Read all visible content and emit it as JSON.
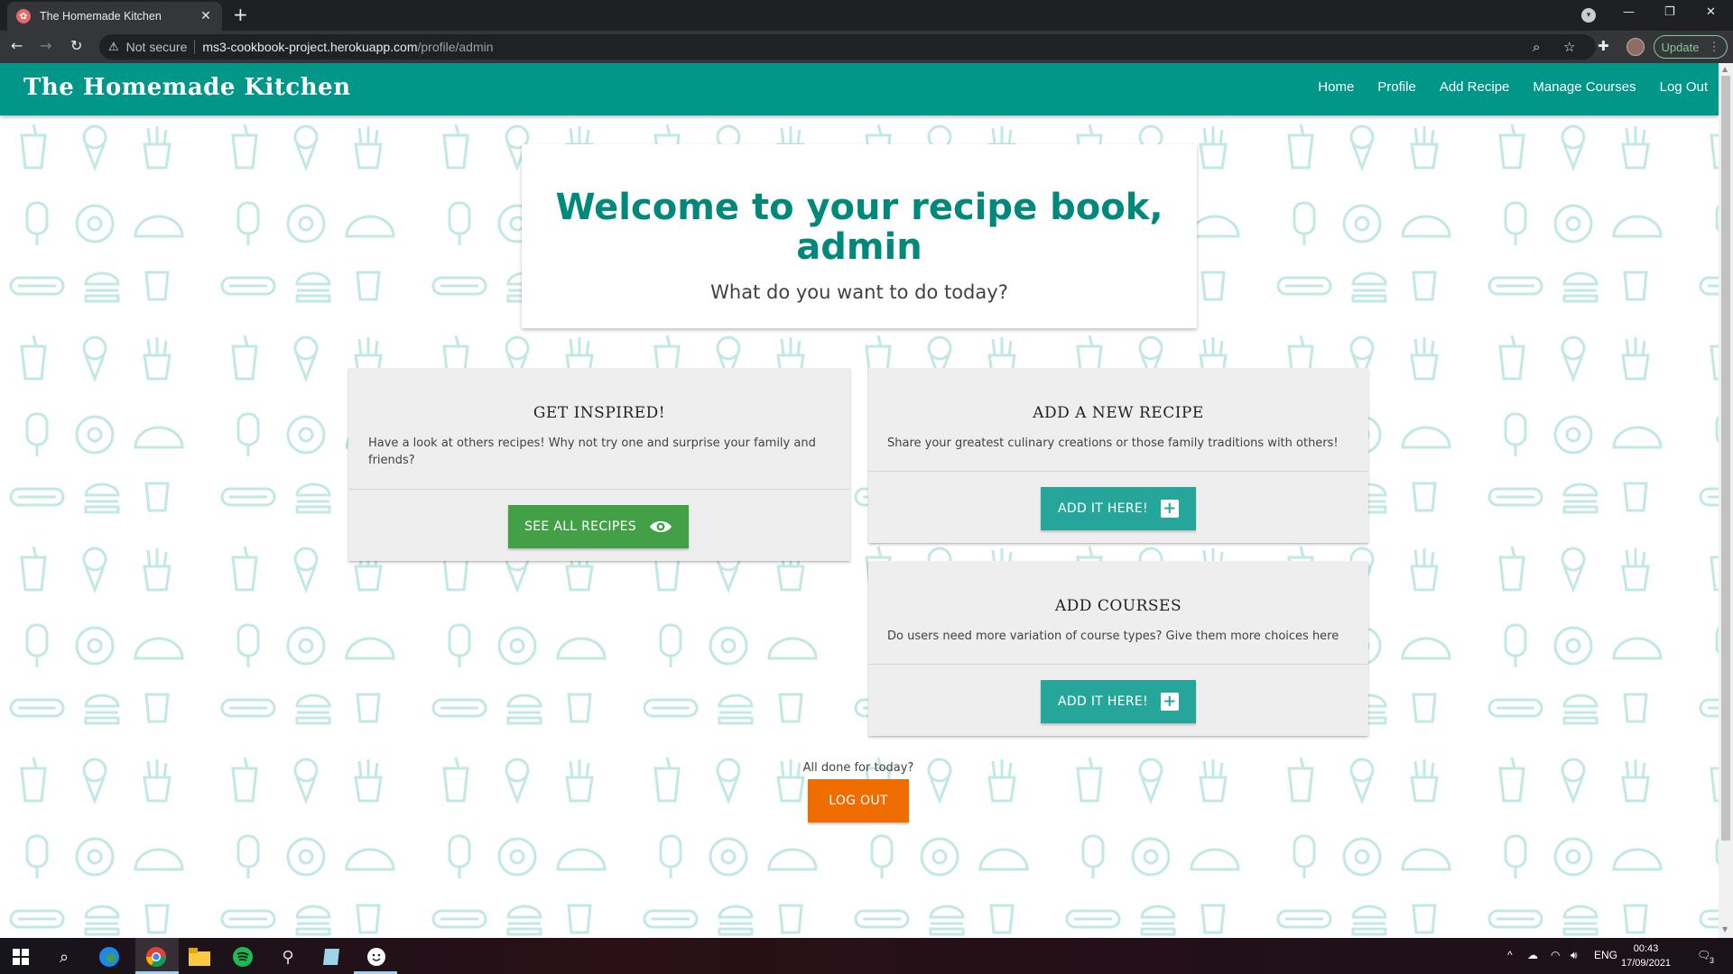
{
  "browser": {
    "tab_title": "The Homemade Kitchen",
    "new_tab": "+",
    "not_secure": "Not secure",
    "url_host": "ms3-cookbook-project.herokuapp.com",
    "url_path": "/profile/admin",
    "update_label": "Update"
  },
  "site": {
    "brand": "The Homemade Kitchen",
    "nav": [
      "Home",
      "Profile",
      "Add Recipe",
      "Manage Courses",
      "Log Out"
    ]
  },
  "hero": {
    "title_line1": "Welcome to your recipe book,",
    "title_line2": "admin",
    "subtitle": "What do you want to do today?"
  },
  "cards": {
    "inspired": {
      "title": "GET INSPIRED!",
      "text": "Have a look at others recipes! Why not try one and surprise your family and friends?",
      "button": "SEE ALL RECIPES"
    },
    "new_recipe": {
      "title": "ADD A NEW RECIPE",
      "text": "Share your greatest culinary creations or those family traditions with others!",
      "button": "ADD IT HERE!"
    },
    "courses": {
      "title": "ADD COURSES",
      "text": "Do users need more variation of course types? Give them more choices here",
      "button": "ADD IT HERE!"
    }
  },
  "footer_prompt": {
    "text": "All done for today?",
    "button": "LOG OUT"
  },
  "taskbar": {
    "language": "ENG",
    "time": "00:43",
    "date": "17/09/2021",
    "notifications": "3"
  },
  "colors": {
    "navbar": "#009688",
    "hero_title": "#00897b",
    "btn_green": "#43a047",
    "btn_teal": "#26a69a",
    "btn_orange": "#ef6c00",
    "pattern": "#b9e3df"
  }
}
